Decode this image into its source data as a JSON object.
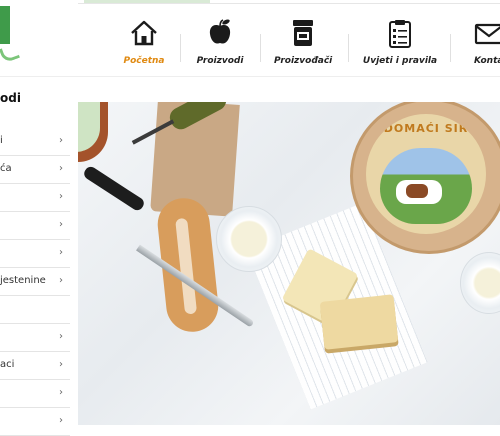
{
  "nav": {
    "items": [
      {
        "label": "Početna",
        "icon": "home-icon",
        "active": true
      },
      {
        "label": "Proizvodi",
        "icon": "apple-icon",
        "active": false
      },
      {
        "label": "Proizvođači",
        "icon": "jar-icon",
        "active": false
      },
      {
        "label": "Uvjeti i pravila",
        "icon": "clipboard-icon",
        "active": false
      },
      {
        "label": "Konta",
        "icon": "envelope-icon",
        "active": false
      }
    ]
  },
  "sidebar": {
    "title": "odi",
    "categories": [
      {
        "label": "i"
      },
      {
        "label": "ća"
      },
      {
        "label": ""
      },
      {
        "label": ""
      },
      {
        "label": ""
      },
      {
        "label": "jestenine"
      },
      {
        "label": ""
      },
      {
        "label": ""
      },
      {
        "label": "aci"
      },
      {
        "label": ""
      },
      {
        "label": ""
      }
    ]
  },
  "hero": {
    "cheese_label": "DOMAĆI SIR"
  },
  "colors": {
    "accent": "#e08a12",
    "brand_green": "#3f9b4a"
  }
}
